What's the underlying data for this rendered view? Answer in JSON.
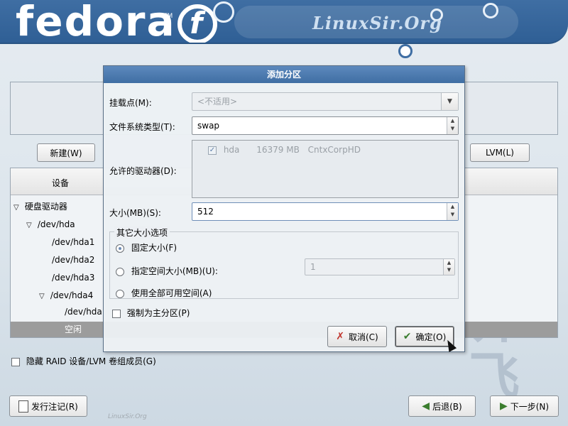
{
  "header": {
    "brand": "fedora",
    "tm": "TM",
    "brand_mark": "f",
    "site_watermark": "LinuxSir.Org"
  },
  "background": {
    "watermark_text": "梦想 齐飞",
    "footer_watermark": "LinuxSir.Org"
  },
  "toolbar": {
    "new_label": "新建(W)",
    "new_mnemonic": "W",
    "lvm_label": "LVM(L)",
    "lvm_mnemonic": "L"
  },
  "tree": {
    "column_header": "设备",
    "rows": [
      {
        "label": "硬盘驱动器",
        "indent": 0,
        "expanded": true
      },
      {
        "label": "/dev/hda",
        "indent": 1,
        "expanded": true
      },
      {
        "label": "/dev/hda1",
        "indent": 2,
        "expanded": null
      },
      {
        "label": "/dev/hda2",
        "indent": 2,
        "expanded": null
      },
      {
        "label": "/dev/hda3",
        "indent": 2,
        "expanded": null
      },
      {
        "label": "/dev/hda4",
        "indent": 2,
        "expanded": true
      },
      {
        "label": "/dev/hda",
        "indent": 3,
        "expanded": null
      }
    ],
    "selected_row_label": "空闲"
  },
  "hide_raid_checkbox": {
    "label": "隐藏 RAID 设备/LVM 卷组成员(G)",
    "checked": false
  },
  "footer": {
    "release_notes_label": "发行注记(R)",
    "back_label": "后退(B)",
    "next_label": "下一步(N)"
  },
  "dialog": {
    "title": "添加分区",
    "mount_point_label": "挂载点(M):",
    "mount_point_value": "<不适用>",
    "fs_type_label": "文件系统类型(T):",
    "fs_type_value": "swap",
    "drives_label": "允许的驱动器(D):",
    "drives": [
      {
        "checked": true,
        "name": "hda",
        "size": "16379 MB",
        "model": "CntxCorpHD"
      }
    ],
    "size_label": "大小(MB)(S):",
    "size_value": "512",
    "other_size_legend": "其它大小选项",
    "options": [
      {
        "label": "固定大小(F)",
        "selected": true
      },
      {
        "label": "指定空间大小(MB)(U):",
        "selected": false
      },
      {
        "label": "使用全部可用空间(A)",
        "selected": false
      }
    ],
    "max_size_value": "1",
    "force_primary_label": "强制为主分区(P)",
    "force_primary_checked": false,
    "cancel_label": "取消(C)",
    "ok_label": "确定(O)"
  },
  "colors": {
    "header_blue": "#3f6ea3",
    "title_blue": "#4a78ad",
    "selected_row": "#9c9c9c"
  }
}
